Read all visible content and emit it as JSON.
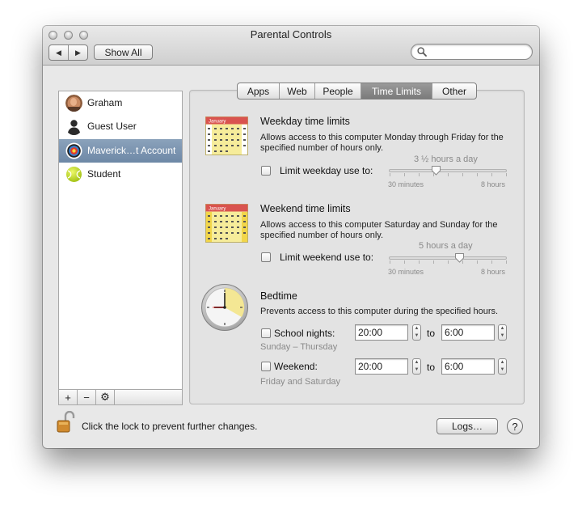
{
  "window": {
    "title": "Parental Controls",
    "show_all": "Show All",
    "search_placeholder": ""
  },
  "nav": {
    "back": "◀",
    "forward": "▶"
  },
  "users": [
    {
      "name": "Graham",
      "selected": false
    },
    {
      "name": "Guest User",
      "selected": false
    },
    {
      "name": "Maverick…t Account",
      "selected": true
    },
    {
      "name": "Student",
      "selected": false
    }
  ],
  "list_buttons": {
    "add": "+",
    "remove": "−",
    "action": "⚙"
  },
  "tabs": [
    {
      "label": "Apps",
      "active": false
    },
    {
      "label": "Web",
      "active": false
    },
    {
      "label": "People",
      "active": false
    },
    {
      "label": "Time Limits",
      "active": true
    },
    {
      "label": "Other",
      "active": false
    }
  ],
  "weekday": {
    "calendar_month": "January",
    "heading": "Weekday time limits",
    "description_1": "Allows access to this computer Monday through Friday for the",
    "description_2": "specified number of hours only.",
    "checkbox_label": "Limit weekday use to:",
    "checked": false,
    "value_label": "3 ½ hours a day",
    "min_label": "30 minutes",
    "max_label": "8 hours",
    "slider_fraction": 0.4
  },
  "weekend": {
    "calendar_month": "January",
    "heading": "Weekend time limits",
    "description_1": "Allows access to this computer Saturday and Sunday for the",
    "description_2": "specified number of hours only.",
    "checkbox_label": "Limit weekend use to:",
    "checked": false,
    "value_label": "5 hours a day",
    "min_label": "30 minutes",
    "max_label": "8 hours",
    "slider_fraction": 0.6
  },
  "bedtime": {
    "heading": "Bedtime",
    "description": "Prevents access to this computer during the specified hours.",
    "school_nights": {
      "label": "School nights:",
      "sub": "Sunday – Thursday",
      "checked": false,
      "from": "20:00",
      "to_label": "to",
      "to": "6:00"
    },
    "weekend": {
      "label": "Weekend:",
      "sub": "Friday and Saturday",
      "checked": false,
      "from": "20:00",
      "to_label": "to",
      "to": "6:00"
    }
  },
  "footer": {
    "lock_text": "Click the lock to prevent further changes.",
    "logs_button": "Logs…",
    "help": "?"
  },
  "colors": {
    "selection": "#7890ad",
    "calendar_header": "#d9534f",
    "calendar_body": "#f6ec9a",
    "clock_face": "#f5f5f5",
    "clock_wedge": "#f4e58a",
    "student_ball": "#c8e02a"
  }
}
